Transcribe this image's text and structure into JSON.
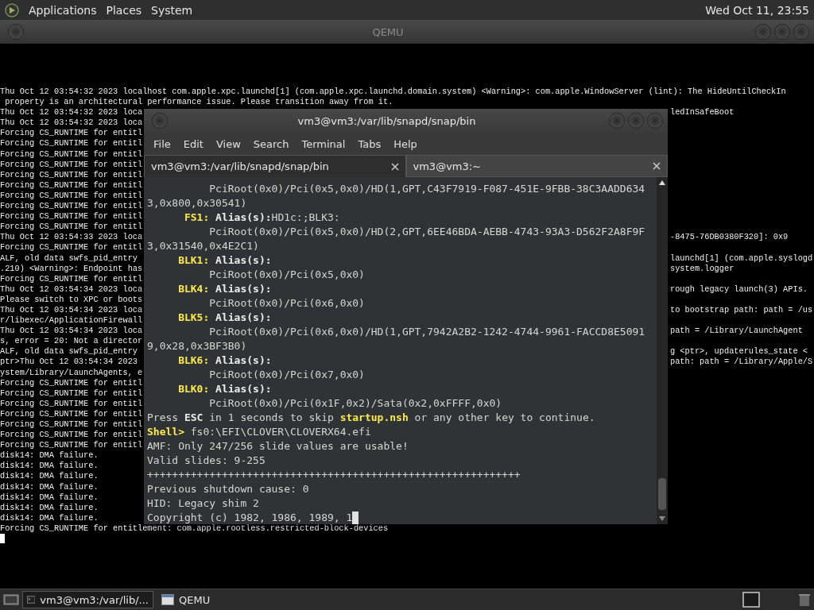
{
  "top_panel": {
    "menus": [
      "Applications",
      "Places",
      "System"
    ],
    "clock": "Wed Oct 11, 23:55"
  },
  "qemu": {
    "title": "QEMU",
    "console": [
      {
        "left": "Thu Oct 12 03:54:32 2023 localhost com.apple.xpc.launchd[1] (com.apple.xpc.launchd.domain.system) <Warning>: com.apple.WindowServer (lint): The HideUntilCheckIn"
      },
      {
        "left": " property is an architectural performance issue. Please transition away from it."
      },
      {
        "left": "Thu Oct 12 03:54:32 2023 loca",
        "right": "ledInSafeBoot"
      },
      {
        "left": "Thu Oct 12 03:54:32 2023 loca"
      },
      {
        "left": "Forcing CS_RUNTIME for entitl"
      },
      {
        "left": "Forcing CS_RUNTIME for entitl"
      },
      {
        "left": "Forcing CS_RUNTIME for entitl"
      },
      {
        "left": "Forcing CS_RUNTIME for entitl"
      },
      {
        "left": "Forcing CS_RUNTIME for entitl"
      },
      {
        "left": "Forcing CS_RUNTIME for entitl"
      },
      {
        "left": "Forcing CS_RUNTIME for entitl"
      },
      {
        "left": "Forcing CS_RUNTIME for entitl"
      },
      {
        "left": "Forcing CS_RUNTIME for entitl"
      },
      {
        "left": "Forcing CS_RUNTIME for entitl"
      },
      {
        "left": "Thu Oct 12 03:54:33 2023 loca",
        "right": "-8475-76DB0380F320]: 0x9"
      },
      {
        "left": "Forcing CS_RUNTIME for entitl"
      },
      {
        "left": "ALF, old data swfs_pid_entry",
        "right": "launchd[1] (com.apple.syslogd"
      },
      {
        "left": ".210) <Warning>: Endpoint has",
        "right": "system.logger"
      },
      {
        "left": "Forcing CS_RUNTIME for entitl"
      },
      {
        "left": "Thu Oct 12 03:54:34 2023 loca",
        "right": "rough legacy launch(3) APIs."
      },
      {
        "left": "Please switch to XPC or boots"
      },
      {
        "left": "Thu Oct 12 03:54:34 2023 loca",
        "right": "to bootstrap path: path = /us"
      },
      {
        "left": "r/libexec/ApplicationFirewall"
      },
      {
        "left": "Thu Oct 12 03:54:34 2023 loca",
        "right": "path = /Library/LaunchAgent"
      },
      {
        "left": "s, error = 20: Not a director"
      },
      {
        "left": "ALF, old data swfs_pid_entry",
        "right": "g <ptr>, updaterules_state <"
      },
      {
        "left": "ptr>Thu Oct 12 03:54:34 2023",
        "right": "path: path = /Library/Apple/S"
      },
      {
        "left": "ystem/Library/LaunchAgents, e"
      },
      {
        "left": "Forcing CS_RUNTIME for entitl"
      },
      {
        "left": "Forcing CS_RUNTIME for entitl"
      },
      {
        "left": "Forcing CS_RUNTIME for entitl"
      },
      {
        "left": "Forcing CS_RUNTIME for entitl"
      },
      {
        "left": "Forcing CS_RUNTIME for entitl"
      },
      {
        "left": "Forcing CS_RUNTIME for entitl"
      },
      {
        "left": "Forcing CS_RUNTIME for entitl"
      },
      {
        "left": "disk14: DMA failure."
      },
      {
        "left": "disk14: DMA failure."
      },
      {
        "left": "disk14: DMA failure."
      },
      {
        "left": "disk14: DMA failure."
      },
      {
        "left": "disk14: DMA failure."
      },
      {
        "left": "disk14: DMA failure."
      },
      {
        "left": "disk14: DMA failure."
      },
      {
        "left": "Forcing CS_RUNTIME for entitlement: com.apple.rootless.restricted-block-devices"
      }
    ]
  },
  "terminal": {
    "title": "vm3@vm3:/var/lib/snapd/snap/bin",
    "menus": [
      "File",
      "Edit",
      "View",
      "Search",
      "Terminal",
      "Tabs",
      "Help"
    ],
    "tabs": [
      {
        "label": "vm3@vm3:/var/lib/snapd/snap/bin",
        "selected": true
      },
      {
        "label": "vm3@vm3:~",
        "selected": false
      }
    ],
    "lines": [
      [
        {
          "kind": "plain",
          "text": "          PciRoot(0x0)/Pci(0x5,0x0)/HD(1,GPT,C43F7919-F087-451E-9FBB-38C3AADD634"
        }
      ],
      [
        {
          "kind": "plain",
          "text": "3,0x800,0x30541)"
        }
      ],
      [
        {
          "kind": "label",
          "text": "      FS1:"
        },
        {
          "kind": "strong",
          "text": " Alias(s):"
        },
        {
          "kind": "plain",
          "text": "HD1c:;BLK3:"
        }
      ],
      [
        {
          "kind": "plain",
          "text": "          PciRoot(0x0)/Pci(0x5,0x0)/HD(2,GPT,6EE46BDA-AEBB-4743-93A3-D562F2A8F9F"
        }
      ],
      [
        {
          "kind": "plain",
          "text": "3,0x31540,0x4E2C1)"
        }
      ],
      [
        {
          "kind": "label",
          "text": "     BLK1:"
        },
        {
          "kind": "strong",
          "text": " Alias(s):"
        }
      ],
      [
        {
          "kind": "plain",
          "text": "          PciRoot(0x0)/Pci(0x5,0x0)"
        }
      ],
      [
        {
          "kind": "label",
          "text": "     BLK4:"
        },
        {
          "kind": "strong",
          "text": " Alias(s):"
        }
      ],
      [
        {
          "kind": "plain",
          "text": "          PciRoot(0x0)/Pci(0x6,0x0)"
        }
      ],
      [
        {
          "kind": "label",
          "text": "     BLK5:"
        },
        {
          "kind": "strong",
          "text": " Alias(s):"
        }
      ],
      [
        {
          "kind": "plain",
          "text": "          PciRoot(0x0)/Pci(0x6,0x0)/HD(1,GPT,7942A2B2-1242-4744-9961-FACCD8E5091"
        }
      ],
      [
        {
          "kind": "plain",
          "text": "9,0x28,0x3BF3B0)"
        }
      ],
      [
        {
          "kind": "label",
          "text": "     BLK6:"
        },
        {
          "kind": "strong",
          "text": " Alias(s):"
        }
      ],
      [
        {
          "kind": "plain",
          "text": "          PciRoot(0x0)/Pci(0x7,0x0)"
        }
      ],
      [
        {
          "kind": "label",
          "text": "     BLK0:"
        },
        {
          "kind": "strong",
          "text": " Alias(s):"
        }
      ],
      [
        {
          "kind": "plain",
          "text": "          PciRoot(0x0)/Pci(0x1F,0x2)/Sata(0x2,0xFFFF,0x0)"
        }
      ],
      [
        {
          "kind": "plain",
          "text": "Press "
        },
        {
          "kind": "strong",
          "text": "ESC"
        },
        {
          "kind": "plain",
          "text": " in 1 seconds to skip "
        },
        {
          "kind": "label",
          "text": "startup.nsh"
        },
        {
          "kind": "plain",
          "text": " or any other key to continue."
        }
      ],
      [
        {
          "kind": "label",
          "text": "Shell>"
        },
        {
          "kind": "plain",
          "text": " fs0:\\EFI\\CLOVER\\CLOVERX64.efi"
        }
      ],
      [
        {
          "kind": "plain",
          "text": "AMF: Only 247/256 slide values are usable!"
        }
      ],
      [
        {
          "kind": "plain",
          "text": "Valid slides: 9-255"
        }
      ],
      [
        {
          "kind": "plain",
          "text": "++++++++++++++++++++++++++++++++++++++++++++++++++++++++++++"
        }
      ],
      [
        {
          "kind": "plain",
          "text": "Previous shutdown cause: 0"
        }
      ],
      [
        {
          "kind": "plain",
          "text": "HID: Legacy shim 2"
        }
      ],
      [
        {
          "kind": "plain",
          "text": "Copyright (c) 1982, 1986, 1989, 1"
        }
      ]
    ]
  },
  "taskbar": {
    "tasks": [
      {
        "label": "vm3@vm3:/var/lib/...",
        "kind": "terminal",
        "selected": true
      },
      {
        "label": "QEMU",
        "kind": "window",
        "selected": false
      }
    ]
  }
}
